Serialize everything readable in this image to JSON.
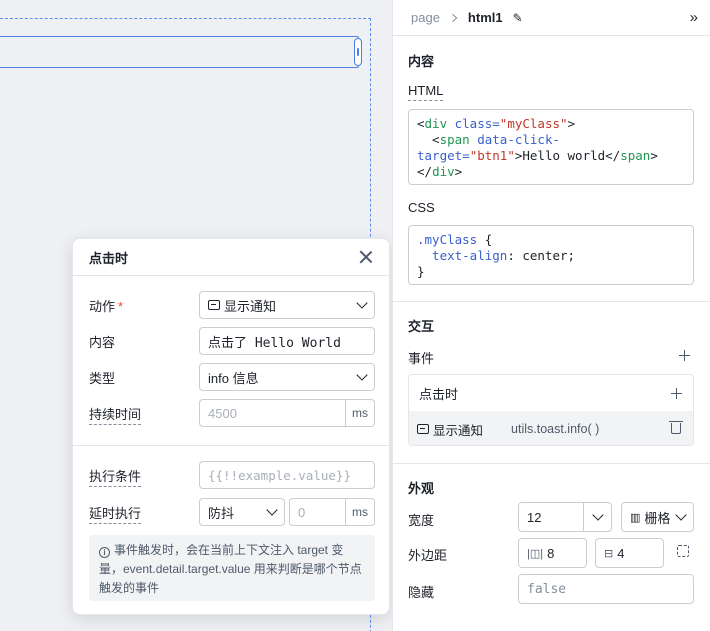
{
  "event_modal": {
    "title": "点击时",
    "action_label": "动作",
    "action_required_mark": "*",
    "action_value": "显示通知",
    "content_label": "内容",
    "content_value": "点击了 Hello World",
    "type_label": "类型",
    "type_value": "info 信息",
    "duration_label": "持续时间",
    "duration_placeholder": "4500",
    "duration_unit": "ms",
    "condition_label": "执行条件",
    "condition_placeholder": "{{!!example.value}}",
    "delay_label": "延时执行",
    "delay_mode": "防抖",
    "delay_placeholder": "0",
    "delay_unit": "ms",
    "info_icon": "i",
    "info_text": "事件触发时，会在当前上下文注入 target 变量，event.detail.target.value 用来判断是哪个节点触发的事件"
  },
  "panel": {
    "breadcrumb_root": "page",
    "breadcrumb_current": "html1",
    "edit_icon": "✎",
    "collapse_icon": "»",
    "content_section": "内容",
    "html_label": "HTML",
    "html_code": {
      "l1_open": "<",
      "l1_tag": "div",
      "l1_attr": " class=",
      "l1_str": "\"myClass\"",
      "l1_close": ">",
      "l2_indent": "  <",
      "l2_tag": "span",
      "l2_attr": " data-click-",
      "l3_attr": "target=",
      "l3_str": "\"btn1\"",
      "l3_text": ">Hello world</",
      "l3_tag": "span",
      "l3_close": ">",
      "l4_open": "</",
      "l4_tag": "div",
      "l4_close": ">"
    },
    "css_label": "CSS",
    "css_code": {
      "selector": ".myClass",
      "brace_open": " {",
      "prop": "  text-align",
      "value": ": center;",
      "brace_close": "}"
    },
    "interaction_section": "交互",
    "events_label": "事件",
    "event_name": "点击时",
    "event_action": "显示通知",
    "event_code": "utils.toast.info( )",
    "appearance_section": "外观",
    "width_label": "宽度",
    "width_value": "12",
    "width_unit": "栅格",
    "margin_label": "外边距",
    "margin_h": "8",
    "margin_v": "4",
    "hidden_label": "隐藏",
    "hidden_placeholder": "false"
  }
}
